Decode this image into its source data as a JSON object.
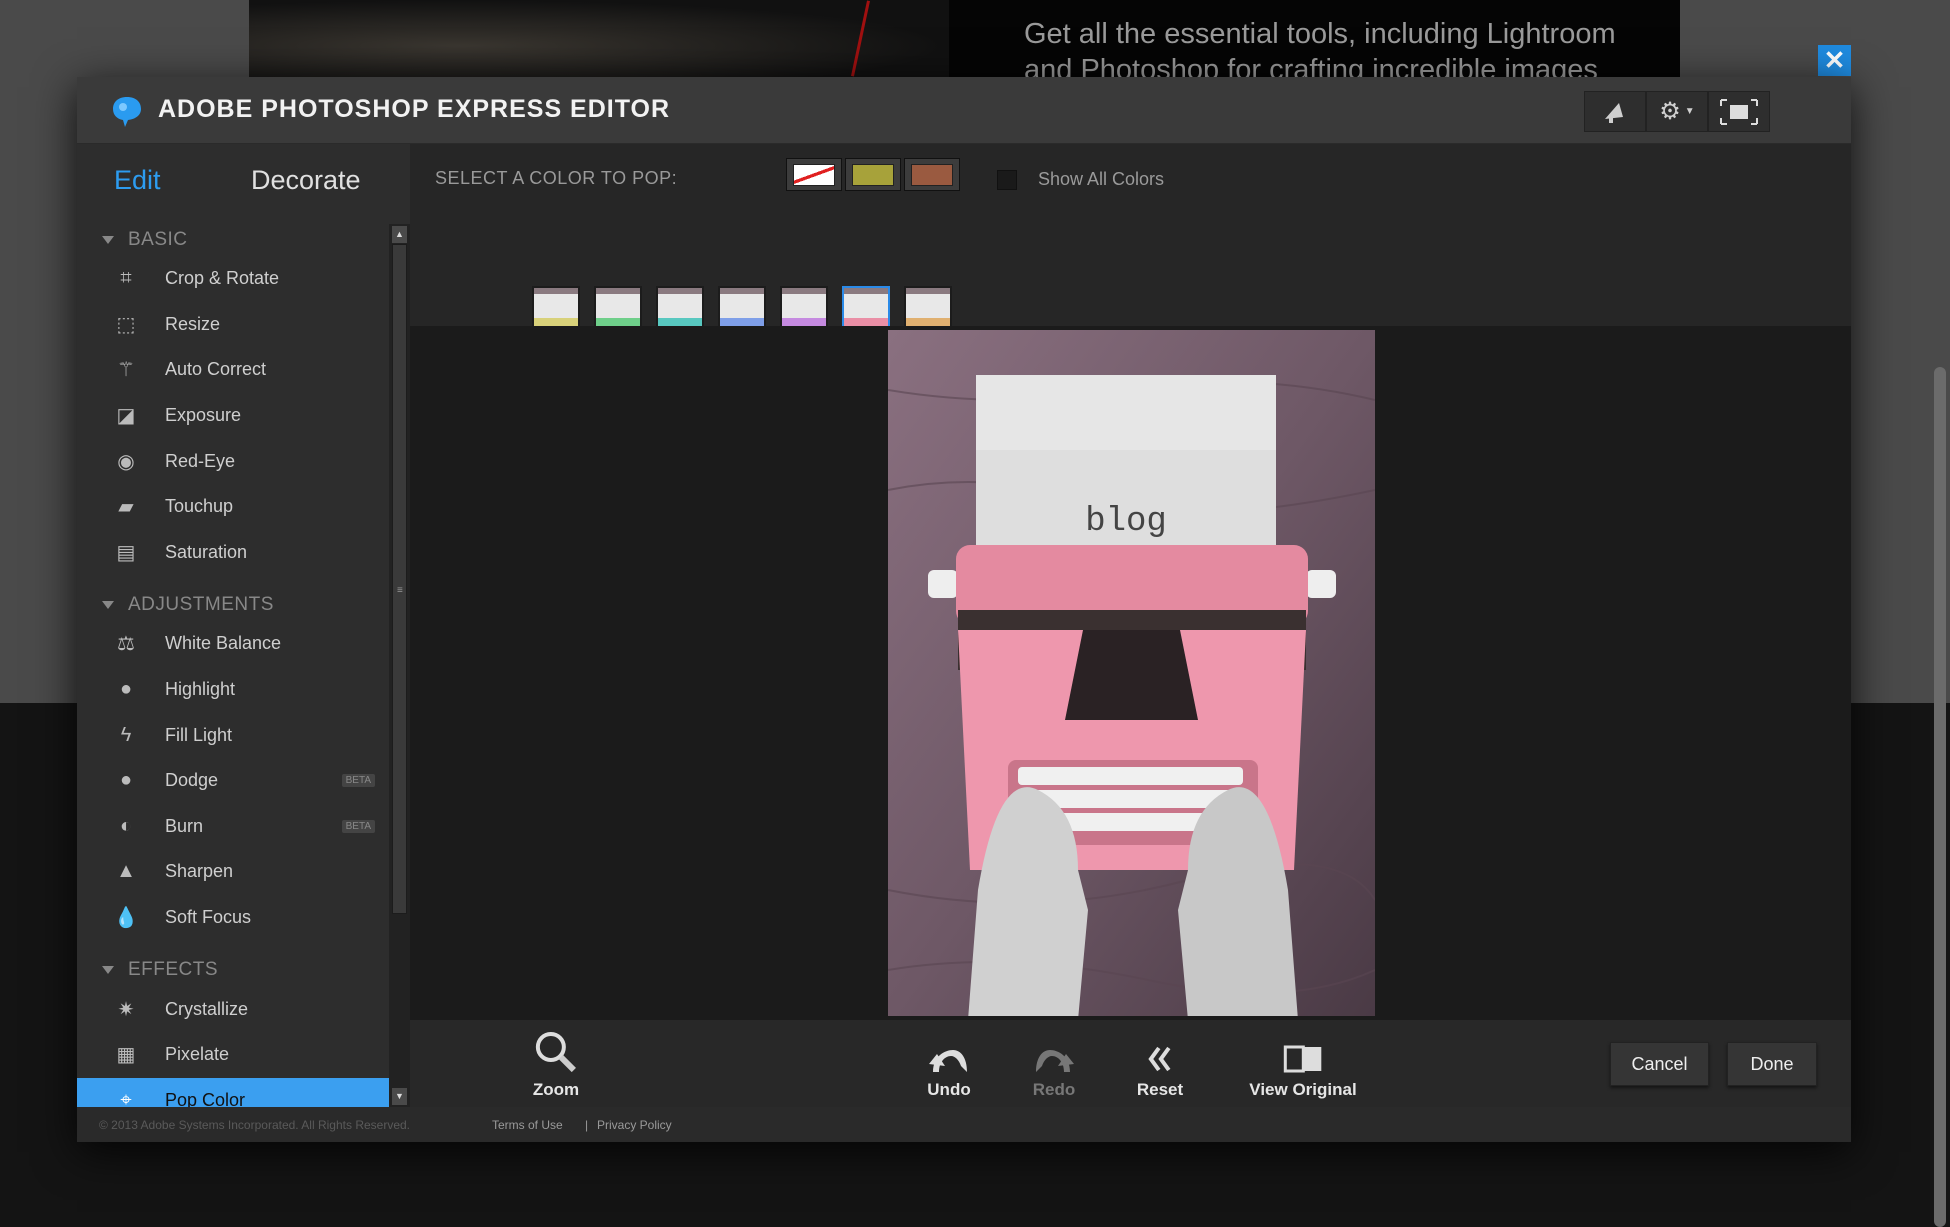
{
  "banner": {
    "line1": "Get all the essential tools, including Lightroom",
    "line2": "and Photoshop for crafting incredible images"
  },
  "window": {
    "title": "ADOBE PHOTOSHOP EXPRESS EDITOR",
    "close_icon": "close-icon",
    "accent": "#2a8ae8"
  },
  "header_buttons": [
    {
      "icon": "megaphone-icon"
    },
    {
      "icon": "gear-icon"
    },
    {
      "icon": "fullscreen-icon"
    }
  ],
  "tabs": [
    {
      "label": "Edit",
      "active": true
    },
    {
      "label": "Decorate",
      "active": false
    }
  ],
  "sidebar": {
    "sections": [
      {
        "title": "BASIC",
        "items": [
          {
            "label": "Crop & Rotate",
            "icon": "crop-icon"
          },
          {
            "label": "Resize",
            "icon": "resize-icon"
          },
          {
            "label": "Auto Correct",
            "icon": "magic-wand-icon"
          },
          {
            "label": "Exposure",
            "icon": "exposure-icon"
          },
          {
            "label": "Red-Eye",
            "icon": "eye-icon"
          },
          {
            "label": "Touchup",
            "icon": "bandage-icon"
          },
          {
            "label": "Saturation",
            "icon": "saturation-icon"
          }
        ]
      },
      {
        "title": "ADJUSTMENTS",
        "items": [
          {
            "label": "White Balance",
            "icon": "scale-icon"
          },
          {
            "label": "Highlight",
            "icon": "bulb-icon"
          },
          {
            "label": "Fill Light",
            "icon": "lightning-icon"
          },
          {
            "label": "Dodge",
            "icon": "dodge-icon",
            "badge": "BETA"
          },
          {
            "label": "Burn",
            "icon": "burn-icon",
            "badge": "BETA"
          },
          {
            "label": "Sharpen",
            "icon": "sharpen-icon"
          },
          {
            "label": "Soft Focus",
            "icon": "drop-icon"
          }
        ]
      },
      {
        "title": "EFFECTS",
        "items": [
          {
            "label": "Crystallize",
            "icon": "crystallize-icon"
          },
          {
            "label": "Pixelate",
            "icon": "pixelate-icon"
          },
          {
            "label": "Pop Color",
            "icon": "target-icon",
            "active": true
          }
        ]
      }
    ]
  },
  "pop_color": {
    "label": "SELECT A COLOR TO POP:",
    "swatches": [
      {
        "name": "none",
        "color": "#ffffff"
      },
      {
        "name": "olive",
        "color": "#a7a23a"
      },
      {
        "name": "brown",
        "color": "#9a5a40"
      }
    ],
    "show_all_colors": {
      "label": "Show All Colors",
      "checked": false
    },
    "presets": [
      {
        "color": "#d8d17a"
      },
      {
        "color": "#6fcf8a"
      },
      {
        "color": "#58c8c0"
      },
      {
        "color": "#7f9fe8"
      },
      {
        "color": "#c58ae0"
      },
      {
        "color": "#ea8fa6",
        "selected": true
      },
      {
        "color": "#e0b070"
      }
    ],
    "slider_position": 0.77
  },
  "photo": {
    "text": "blog"
  },
  "bottom_toolbar": {
    "zoom": "Zoom",
    "undo": "Undo",
    "redo": "Redo",
    "reset": "Reset",
    "view_original": "View Original",
    "cancel": "Cancel",
    "done": "Done"
  },
  "footer": {
    "copyright": "© 2013 Adobe Systems Incorporated. All Rights Reserved.",
    "terms": "Terms of Use",
    "separator": "|",
    "privacy": "Privacy Policy"
  }
}
